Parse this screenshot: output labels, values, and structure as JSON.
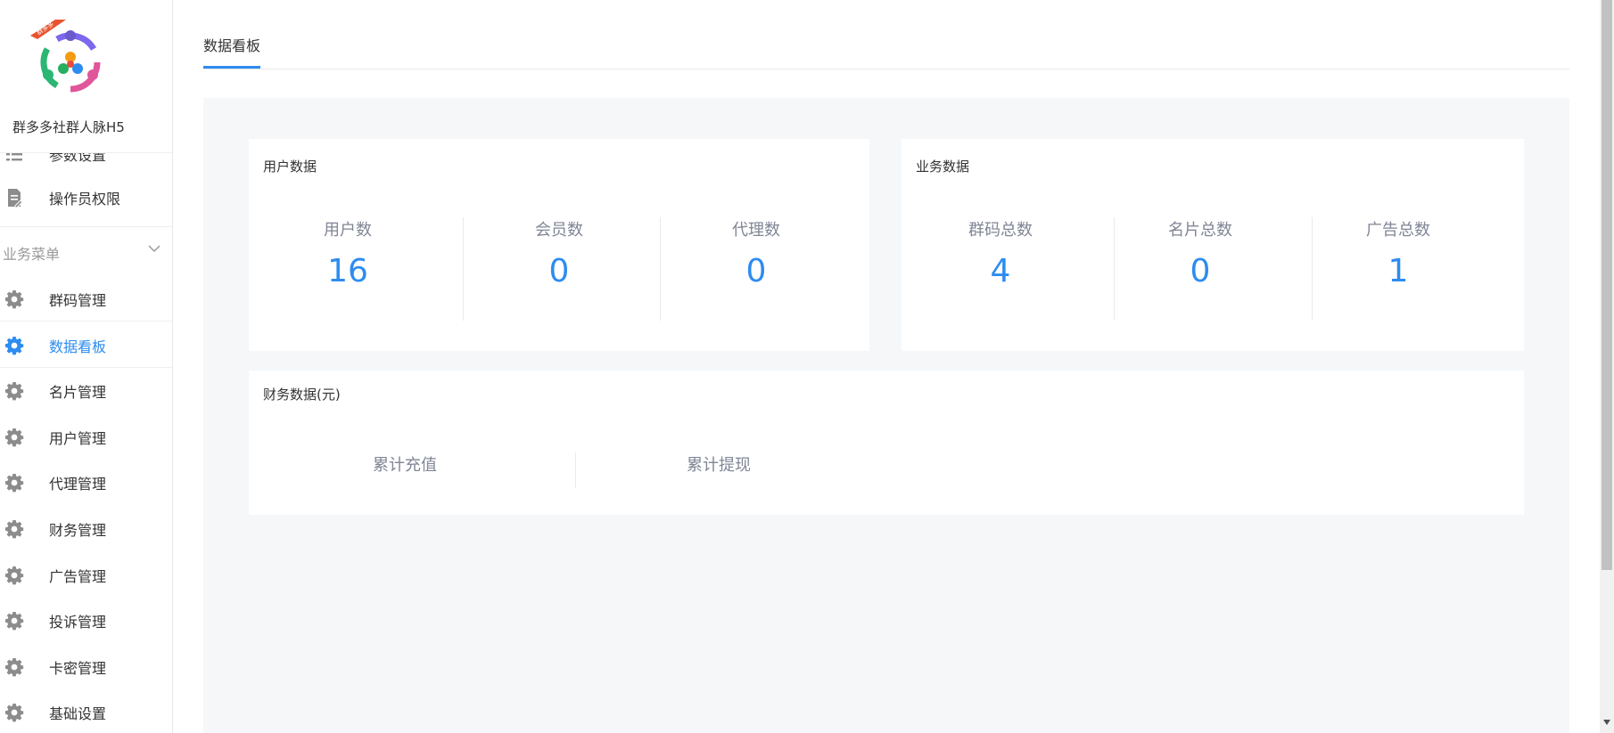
{
  "brand": {
    "name": "群多多社群人脉H5",
    "logo_badge": "群多多"
  },
  "sidebar": {
    "items_top": [
      {
        "label": "参数设置",
        "icon": "list-settings-icon"
      },
      {
        "label": "操作员权限",
        "icon": "document-edit-icon"
      }
    ],
    "group": {
      "label": "业务菜单",
      "icon": "chevron-down-icon"
    },
    "items": [
      {
        "label": "群码管理",
        "icon": "gear-icon"
      },
      {
        "label": "数据看板",
        "icon": "gear-icon",
        "active": true
      },
      {
        "label": "名片管理",
        "icon": "gear-icon"
      },
      {
        "label": "用户管理",
        "icon": "gear-icon"
      },
      {
        "label": "代理管理",
        "icon": "gear-icon"
      },
      {
        "label": "财务管理",
        "icon": "gear-icon"
      },
      {
        "label": "广告管理",
        "icon": "gear-icon"
      },
      {
        "label": "投诉管理",
        "icon": "gear-icon"
      },
      {
        "label": "卡密管理",
        "icon": "gear-icon"
      },
      {
        "label": "基础设置",
        "icon": "gear-icon"
      }
    ]
  },
  "tabs": [
    {
      "label": "数据看板",
      "active": true
    }
  ],
  "user_data": {
    "title": "用户数据",
    "stats": [
      {
        "label": "用户数",
        "value": "16"
      },
      {
        "label": "会员数",
        "value": "0"
      },
      {
        "label": "代理数",
        "value": "0"
      }
    ]
  },
  "business_data": {
    "title": "业务数据",
    "stats": [
      {
        "label": "群码总数",
        "value": "4"
      },
      {
        "label": "名片总数",
        "value": "0"
      },
      {
        "label": "广告总数",
        "value": "1"
      }
    ]
  },
  "finance_data": {
    "title": "财务数据(元)",
    "stats": [
      {
        "label": "累计充值"
      },
      {
        "label": "累计提现"
      }
    ]
  },
  "colors": {
    "accent": "#2d8cf0",
    "icon_gray": "#8c8c8c",
    "content_bg": "#f5f7f9",
    "muted_text": "#808695"
  }
}
